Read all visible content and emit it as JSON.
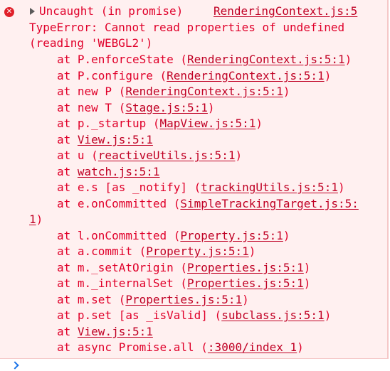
{
  "error": {
    "icon": "error-circle-icon",
    "title": "Uncaught (in promise)",
    "source_link": "RenderingContext.js:5",
    "message_line1": "TypeError: Cannot read properties of undefined",
    "message_line2": "(reading 'WEBGL2')"
  },
  "stack": [
    {
      "prefix": "at P.enforceState (",
      "link": "RenderingContext.js:5:1",
      "suffix": ")"
    },
    {
      "prefix": "at P.configure (",
      "link": "RenderingContext.js:5:1",
      "suffix": ")"
    },
    {
      "prefix": "at new P (",
      "link": "RenderingContext.js:5:1",
      "suffix": ")"
    },
    {
      "prefix": "at new T (",
      "link": "Stage.js:5:1",
      "suffix": ")"
    },
    {
      "prefix": "at p._startup (",
      "link": "MapView.js:5:1",
      "suffix": ")"
    },
    {
      "prefix": "at ",
      "link": "View.js:5:1",
      "suffix": ""
    },
    {
      "prefix": "at u (",
      "link": "reactiveUtils.js:5:1",
      "suffix": ")"
    },
    {
      "prefix": "at ",
      "link": "watch.js:5:1",
      "suffix": ""
    },
    {
      "prefix": "at e.s [as _notify] (",
      "link": "trackingUtils.js:5:1",
      "suffix": ")"
    },
    {
      "prefix": "at e.onCommitted (",
      "link": "SimpleTrackingTarget.js:5:",
      "suffix": ""
    },
    {
      "prefix": "",
      "link": "1",
      "suffix": ")"
    },
    {
      "prefix": "at l.onCommitted (",
      "link": "Property.js:5:1",
      "suffix": ")"
    },
    {
      "prefix": "at a.commit (",
      "link": "Property.js:5:1",
      "suffix": ")"
    },
    {
      "prefix": "at m._setAtOrigin (",
      "link": "Properties.js:5:1",
      "suffix": ")"
    },
    {
      "prefix": "at m._internalSet (",
      "link": "Properties.js:5:1",
      "suffix": ")"
    },
    {
      "prefix": "at m.set (",
      "link": "Properties.js:5:1",
      "suffix": ")"
    },
    {
      "prefix": "at p.set [as _isValid] (",
      "link": "subclass.js:5:1",
      "suffix": ")"
    },
    {
      "prefix": "at ",
      "link": "View.js:5:1",
      "suffix": ""
    },
    {
      "prefix": "at async Promise.all (",
      "link": ":3000/index 1",
      "suffix": ")"
    }
  ],
  "prompt": {
    "icon": "chevron-right-icon"
  }
}
